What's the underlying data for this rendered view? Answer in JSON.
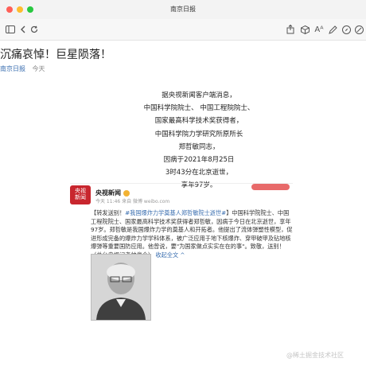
{
  "window": {
    "title": "南京日报",
    "traffic_colors": [
      "#ff5f57",
      "#febc2e",
      "#28c840"
    ]
  },
  "toolbar": {
    "icons_left": [
      "sidebar-icon",
      "chevron-left-icon",
      "chevron-right-icon",
      "refresh-icon"
    ],
    "icons_right": [
      "share-icon",
      "box-icon",
      "font-size-icon",
      "edit-icon",
      "compass-icon",
      "safari-icon"
    ]
  },
  "article": {
    "headline": "沉痛哀悼！巨星陨落！",
    "source": "南京日报",
    "date": "今天",
    "body_lines": [
      "据央视新闻客户端消息，",
      "中国科学院院士、 中国工程院院士、",
      "国家最高科学技术奖获得者，",
      "中国科学院力学研究所原所长",
      "郑哲敏同志，",
      "因病于2021年8月25日",
      "3时43分在北京逝世，",
      "享年97岁。"
    ]
  },
  "embed": {
    "logo_line1": "央视",
    "logo_line2": "新闻",
    "account": "央视新闻",
    "time": "今天 11:46 来自 微博 weibo.com",
    "post_prefix": "【转发送别！",
    "post_tag": "#我国爆炸力学奠基人郑哲敏院士逝世#",
    "post_text": "】中国科学院院士、中国工程院院士、国家最高科学技术奖获得者郑哲敏，因病于今日在北京逝世，享年97岁。郑哲敏是我国爆炸力学的奠基人和开拓者。他提出了流体弹塑性模型，促进形成完备的爆炸力学学科体系，被广泛应用于地下核爆炸、穿甲破甲及钻地核爆弹等重要国防应用。他曾说，要\"为国家做点实实在在的事\"。致敬，送别！（总台央视记者帅俊全）",
    "expand_label": "收起全文 ^"
  },
  "watermark": "@稀土掘金技术社区"
}
